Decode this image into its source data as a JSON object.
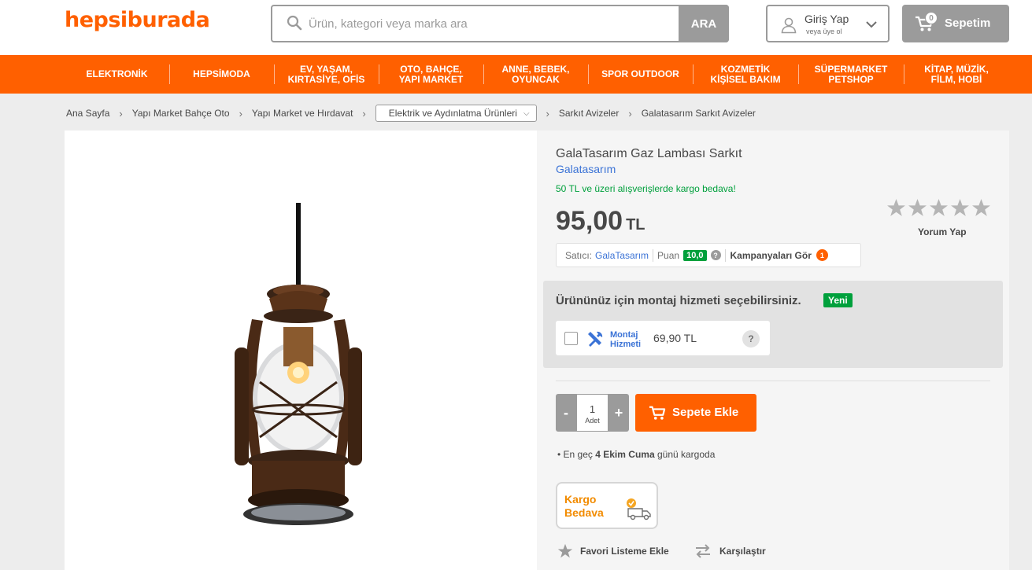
{
  "header": {
    "logo": "hepsiburada",
    "search_placeholder": "Ürün, kategori veya marka ara",
    "search_button": "ARA",
    "login_title": "Giriş Yap",
    "login_sub": "veya üye ol",
    "cart_label": "Sepetim",
    "cart_count": "0"
  },
  "nav": [
    {
      "line1": "ELEKTRONİK",
      "line2": ""
    },
    {
      "line1": "HEPSİMODA",
      "line2": ""
    },
    {
      "line1": "EV, YAŞAM,",
      "line2": "KIRTASİYE, OFİS"
    },
    {
      "line1": "OTO, BAHÇE,",
      "line2": "YAPI MARKET"
    },
    {
      "line1": "ANNE, BEBEK,",
      "line2": "OYUNCAK"
    },
    {
      "line1": "SPOR OUTDOOR",
      "line2": ""
    },
    {
      "line1": "KOZMETİK",
      "line2": "KİŞİSEL BAKIM"
    },
    {
      "line1": "SÜPERMARKET",
      "line2": "PETSHOP"
    },
    {
      "line1": "KİTAP, MÜZİK,",
      "line2": "FİLM, HOBİ"
    }
  ],
  "breadcrumb": {
    "items": [
      "Ana Sayfa",
      "Yapı Market Bahçe Oto",
      "Yapı Market ve Hırdavat"
    ],
    "dropdown": "Elektrik ve Aydınlatma Ürünleri",
    "after": [
      "Sarkıt Avizeler",
      "Galatasarım Sarkıt Avizeler"
    ]
  },
  "product": {
    "title": "GalaTasarım Gaz Lambası Sarkıt",
    "brand": "Galatasarım",
    "shipping_note": "50 TL ve üzeri alışverişlerde kargo bedava!",
    "price": "95,00",
    "currency": "TL",
    "review_label": "Yorum Yap",
    "rating": 0
  },
  "seller": {
    "label": "Satıcı:",
    "name": "GalaTasarım",
    "score_label": "Puan",
    "score": "10,0",
    "help": "?",
    "campaigns": "Kampanyaları Gör",
    "campaign_count": "1"
  },
  "montaj": {
    "heading": "Ürününüz için montaj hizmeti seçebilirsiniz.",
    "badge": "Yeni",
    "service_line1": "Montaj",
    "service_line2": "Hizmeti",
    "service_price": "69,90 TL",
    "help": "?"
  },
  "purchase": {
    "minus": "-",
    "plus": "+",
    "quantity": "1",
    "unit": "Adet",
    "add_to_cart": "Sepete Ekle"
  },
  "delivery": {
    "prefix": "En geç",
    "date": "4 Ekim Cuma",
    "suffix": "günü kargoda"
  },
  "kargo": {
    "line1": "Kargo",
    "line2": "Bedava"
  },
  "actions": {
    "favorite": "Favori Listeme Ekle",
    "compare": "Karşılaştır"
  },
  "colors": {
    "brand_orange": "#ff6000",
    "grey": "#9b9b9b",
    "link_blue": "#3b73d6",
    "green": "#00a03c"
  }
}
